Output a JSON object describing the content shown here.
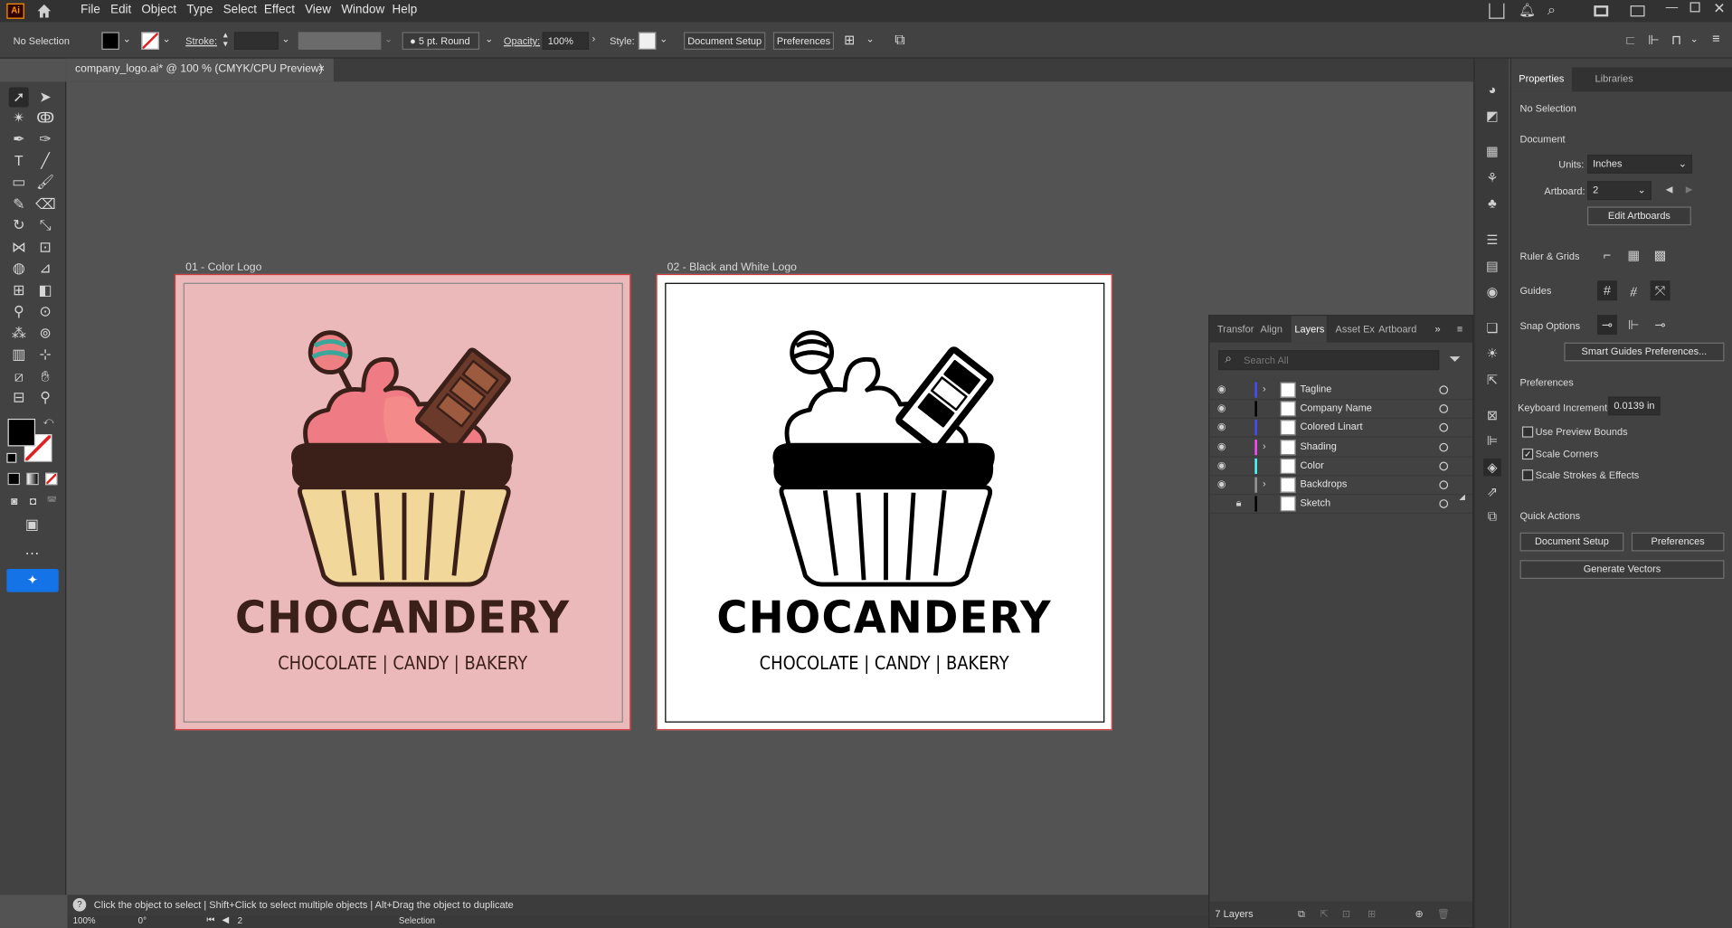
{
  "app": {
    "logo": "Ai"
  },
  "menu": [
    "File",
    "Edit",
    "Object",
    "Type",
    "Select",
    "Effect",
    "View",
    "Window",
    "Help"
  ],
  "options": {
    "selection": "No Selection",
    "stroke_label": "Stroke:",
    "brush": "5 pt. Round",
    "opacity_label": "Opacity:",
    "opacity_value": "100%",
    "style_label": "Style:",
    "document_setup": "Document Setup",
    "preferences": "Preferences"
  },
  "document": {
    "tab_title": "company_logo.ai* @ 100 % (CMYK/CPU Preview)",
    "close": "×"
  },
  "artboards": [
    {
      "label": "01 - Color Logo",
      "brand": "CHOCANDERY",
      "tagline": "CHOCOLATE | CANDY | BAKERY",
      "bg": "#ebb9b9",
      "ink": "#3b1f19"
    },
    {
      "label": "02 - Black and White Logo",
      "brand": "CHOCANDERY",
      "tagline": "CHOCOLATE | CANDY | BAKERY",
      "bg": "#ffffff",
      "ink": "#000000"
    }
  ],
  "status": {
    "hint": "Click the object to select  |  Shift+Click to select multiple objects  |  Alt+Drag the object to duplicate",
    "zoom": "100%",
    "rotation": "0°",
    "artboard_num": "2",
    "tool": "Selection"
  },
  "properties": {
    "tabs": [
      "Properties",
      "Libraries"
    ],
    "no_selection": "No Selection",
    "document_section": "Document",
    "units_label": "Units:",
    "units_value": "Inches",
    "artboard_label": "Artboard:",
    "artboard_value": "2",
    "edit_artboards": "Edit Artboards",
    "ruler_grids": "Ruler & Grids",
    "guides": "Guides",
    "snap_options": "Snap Options",
    "smart_guides": "Smart Guides Preferences...",
    "preferences_section": "Preferences",
    "keyboard_increment_label": "Keyboard Increment:",
    "keyboard_increment_value": "0.0139 in",
    "use_preview_bounds": "Use Preview Bounds",
    "scale_corners": "Scale Corners",
    "scale_strokes": "Scale Strokes & Effects",
    "quick_actions": "Quick Actions",
    "qa_document_setup": "Document Setup",
    "qa_preferences": "Preferences",
    "generate_vectors": "Generate Vectors"
  },
  "layers_panel": {
    "tabs": [
      "Transfor",
      "Align",
      "Layers",
      "Asset Ex",
      "Artboard"
    ],
    "search_placeholder": "Search All",
    "layers": [
      {
        "name": "Tagline",
        "color": "#4c4cff"
      },
      {
        "name": "Company Name",
        "color": "#000000"
      },
      {
        "name": "Colored Linart",
        "color": "#4c4cff"
      },
      {
        "name": "Shading",
        "color": "#ff4cff"
      },
      {
        "name": "Color",
        "color": "#4cffff"
      },
      {
        "name": "Backdrops",
        "color": "#999999"
      },
      {
        "name": "Sketch",
        "color": "#000000"
      }
    ],
    "count": "7 Layers"
  }
}
